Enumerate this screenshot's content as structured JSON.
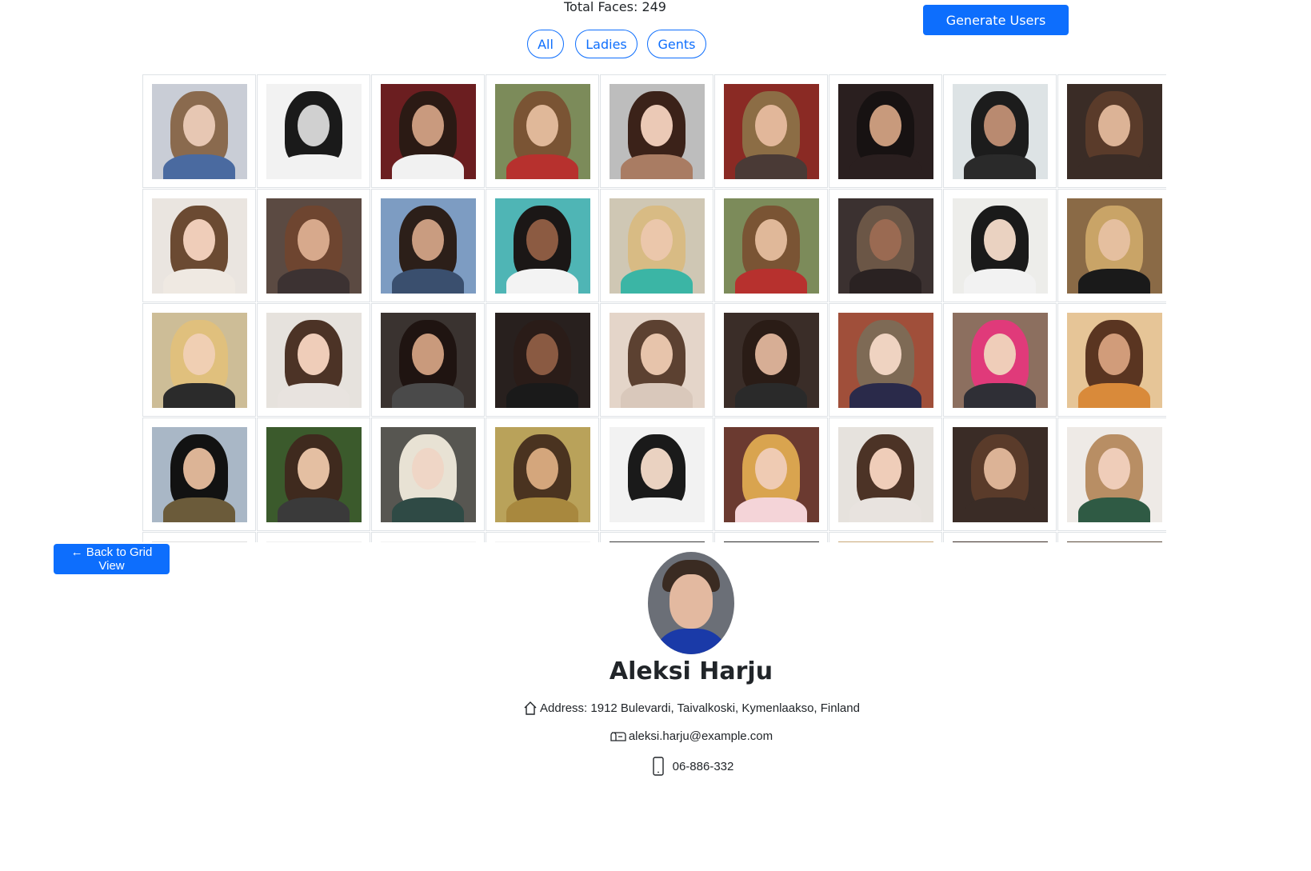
{
  "header": {
    "total_faces": "Total Faces: 249",
    "generate_label": "Generate Users"
  },
  "filters": [
    {
      "label": "All"
    },
    {
      "label": "Ladies"
    },
    {
      "label": "Gents"
    }
  ],
  "grid": {
    "photos": [
      {
        "bg": "#c9cdd6",
        "hair": "#8a6a4e",
        "skin": "#e7c7b3",
        "top": "#4a6aa0"
      },
      {
        "bg": "#f2f2f2",
        "hair": "#1a1a1a",
        "skin": "#d0d0d0",
        "top": "#f2f2f2"
      },
      {
        "bg": "#6b1e20",
        "hair": "#2b1a14",
        "skin": "#c99a7e",
        "top": "#f1f1f1"
      },
      {
        "bg": "#7c8b5a",
        "hair": "#7a5434",
        "skin": "#e0b899",
        "top": "#b7312e"
      },
      {
        "bg": "#bdbdbd",
        "hair": "#3b2219",
        "skin": "#ebc9b6",
        "top": "#a97c63"
      },
      {
        "bg": "#8a2a24",
        "hair": "#8c6d45",
        "skin": "#e2b79a",
        "top": "#4a3a36"
      },
      {
        "bg": "#2a1f1f",
        "hair": "#171212",
        "skin": "#c89a7c",
        "top": "#2a1f1f"
      },
      {
        "bg": "#dde3e5",
        "hair": "#1c1c1c",
        "skin": "#b98a70",
        "top": "#2a2a2a"
      },
      {
        "bg": "#3a2c26",
        "hair": "#5a3b2a",
        "skin": "#dcb396",
        "top": "#3a2c26"
      },
      {
        "bg": "#eae5e0",
        "hair": "#6b4a32",
        "skin": "#efcdb9",
        "top": "#efe9e2"
      },
      {
        "bg": "#5b4a42",
        "hair": "#6e4530",
        "skin": "#d7a98c",
        "top": "#3c3232"
      },
      {
        "bg": "#7d9cc2",
        "hair": "#2c1f19",
        "skin": "#c99c80",
        "top": "#3a4f6e"
      },
      {
        "bg": "#4fb5b5",
        "hair": "#1b1716",
        "skin": "#8c5b42",
        "top": "#f3f3f3"
      },
      {
        "bg": "#cfc7b4",
        "hair": "#d8bb84",
        "skin": "#ebc7ab",
        "top": "#3bb5a5"
      },
      {
        "bg": "#7c8b5a",
        "hair": "#7a5434",
        "skin": "#e0b899",
        "top": "#b7312e"
      },
      {
        "bg": "#3b3130",
        "hair": "#6b5646",
        "skin": "#9a6a52",
        "top": "#2a2222"
      },
      {
        "bg": "#ededea",
        "hair": "#1a1a1a",
        "skin": "#ead2c1",
        "top": "#f2f2f2"
      },
      {
        "bg": "#8a6a46",
        "hair": "#c9a467",
        "skin": "#e5bf9f",
        "top": "#1a1a1a"
      },
      {
        "bg": "#cdbd97",
        "hair": "#e0c07d",
        "skin": "#f0cfb3",
        "top": "#2b2b2b"
      },
      {
        "bg": "#e6e2dd",
        "hair": "#4c3326",
        "skin": "#efcdb9",
        "top": "#e8e3df"
      },
      {
        "bg": "#3a3330",
        "hair": "#1f1411",
        "skin": "#c99a7c",
        "top": "#4a4a4a"
      },
      {
        "bg": "#28201e",
        "hair": "#2a1c18",
        "skin": "#8a5a42",
        "top": "#1a1a1a"
      },
      {
        "bg": "#e4d5c9",
        "hair": "#5c4131",
        "skin": "#e7c4ab",
        "top": "#d9c8bb"
      },
      {
        "bg": "#3a2d28",
        "hair": "#2a1c16",
        "skin": "#d7ae95",
        "top": "#2a2a2a"
      },
      {
        "bg": "#a04f3a",
        "hair": "#7e6a55",
        "skin": "#efd3c1",
        "top": "#2a2a4a"
      },
      {
        "bg": "#8c6f5f",
        "hair": "#e03a7a",
        "skin": "#efcdb9",
        "top": "#2f2f36"
      },
      {
        "bg": "#e6c597",
        "hair": "#5a3521",
        "skin": "#d19c7a",
        "top": "#d98a3a"
      },
      {
        "bg": "#a9b7c6",
        "hair": "#121212",
        "skin": "#dcb496",
        "top": "#6b5b3a"
      },
      {
        "bg": "#3b5a2c",
        "hair": "#3f2a1e",
        "skin": "#e4bfa2",
        "top": "#3a3a3a"
      },
      {
        "bg": "#575651",
        "hair": "#e8e2d4",
        "skin": "#efd6c6",
        "top": "#2f4a45"
      },
      {
        "bg": "#b9a25a",
        "hair": "#4a3320",
        "skin": "#d4a67c",
        "top": "#a8883e"
      },
      {
        "bg": "#f2f2f2",
        "hair": "#1a1a1a",
        "skin": "#ead2c1",
        "top": "#f2f2f2"
      },
      {
        "bg": "#6b3a30",
        "hair": "#d9a44f",
        "skin": "#efcbb3",
        "top": "#f4d4d8"
      },
      {
        "bg": "#e6e2dd",
        "hair": "#4c3326",
        "skin": "#efcdb9",
        "top": "#e8e3df"
      },
      {
        "bg": "#3a2c26",
        "hair": "#5a3b2a",
        "skin": "#dcb396",
        "top": "#3a2c26"
      },
      {
        "bg": "#eeeae6",
        "hair": "#b88e64",
        "skin": "#efcdb9",
        "top": "#2f5a44"
      },
      {
        "bg": "#dedede",
        "hair": "#3a2a22",
        "skin": "#d8b8a0",
        "top": "#cfcfcf"
      },
      {
        "bg": "#f0f0f0",
        "hair": "#c9c9c9",
        "skin": "#e0e0e0",
        "top": "#f0f0f0"
      },
      {
        "bg": "#f3f3f3",
        "hair": "#d9d9d9",
        "skin": "#ececec",
        "top": "#f3f3f3"
      },
      {
        "bg": "#f3f3f3",
        "hair": "#dcdcdc",
        "skin": "#ececec",
        "top": "#f3f3f3"
      },
      {
        "bg": "#3a3a3a",
        "hair": "#2a2a2a",
        "skin": "#5a5a5a",
        "top": "#3a3a3a"
      },
      {
        "bg": "#2a2a2a",
        "hair": "#3a3a3a",
        "skin": "#4a4a4a",
        "top": "#2a2a2a"
      },
      {
        "bg": "#c9a878",
        "hair": "#8a6a48",
        "skin": "#d8b896",
        "top": "#c9a878"
      },
      {
        "bg": "#3a2c26",
        "hair": "#2a1c16",
        "skin": "#4a3a32",
        "top": "#3a2c26"
      },
      {
        "bg": "#5a4a3a",
        "hair": "#3a2a1a",
        "skin": "#6a5a4a",
        "top": "#5a4a3a"
      }
    ]
  },
  "detail": {
    "back_label": "← Back to Grid View",
    "name": "Aleksi Harju",
    "address": "Address: 1912 Bulevardi, Taivalkoski, Kymenlaakso, Finland",
    "email": "aleksi.harju@example.com",
    "phone": "06-886-332"
  },
  "colors": {
    "primary": "#0d6efd",
    "border": "#dee2e6",
    "text": "#212529"
  }
}
